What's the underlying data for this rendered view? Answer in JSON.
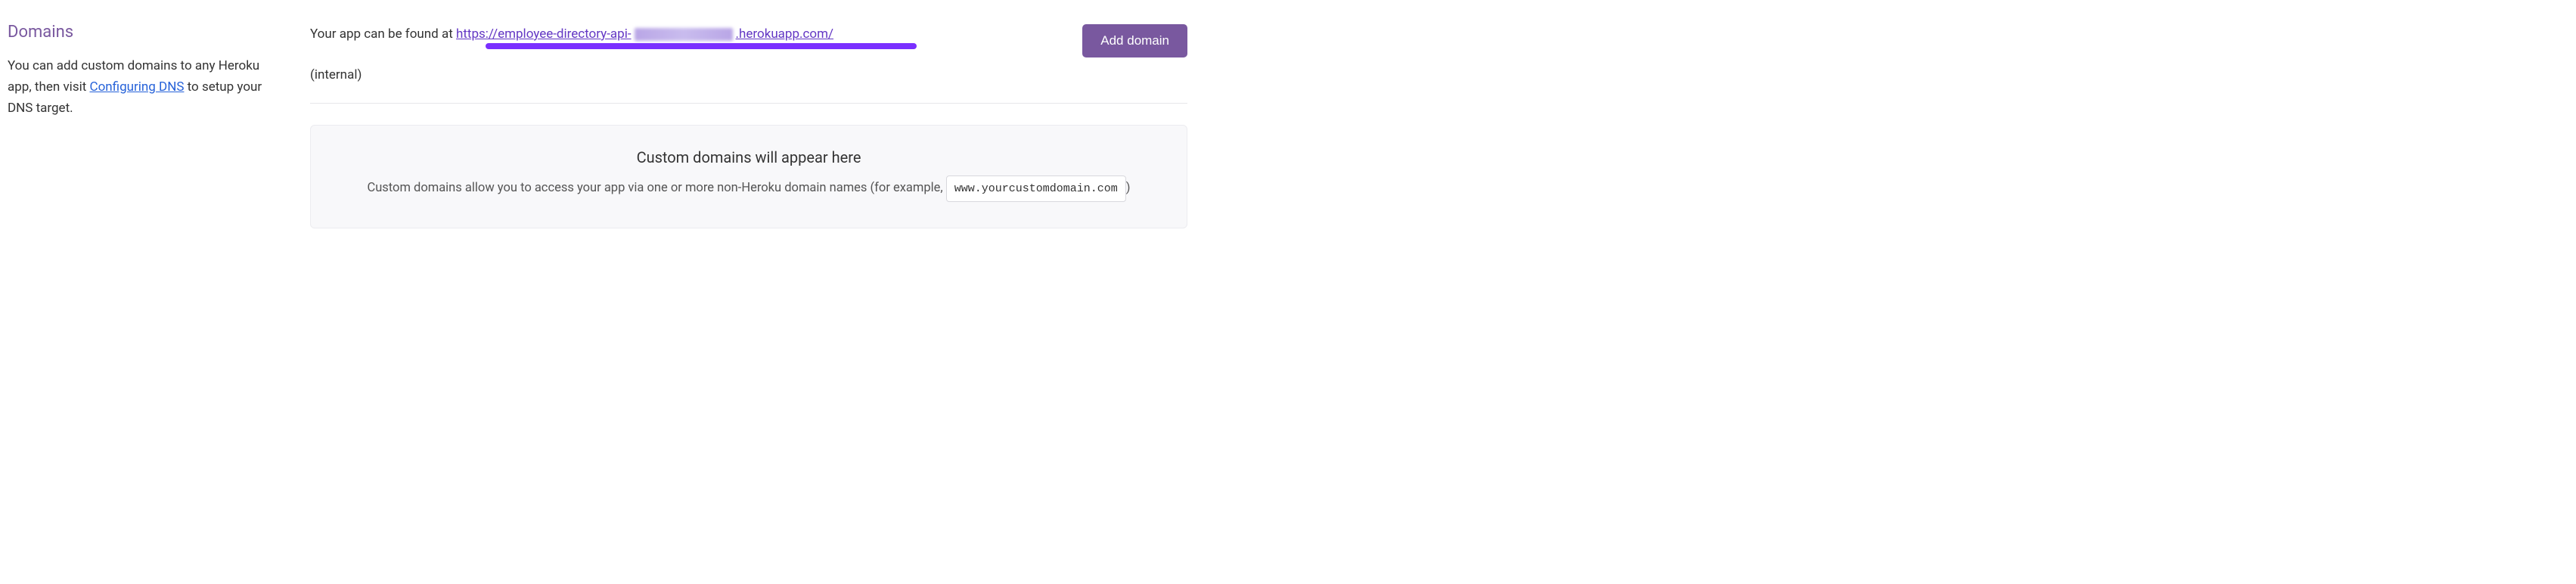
{
  "sidebar": {
    "title": "Domains",
    "desc_before": "You can add custom domains to any Heroku app, then visit ",
    "desc_link": "Configuring DNS",
    "desc_after": " to setup your DNS target."
  },
  "header": {
    "prefix": "Your app can be found at ",
    "url_part1": "https://employee-directory-api-",
    "url_part2": ".herokuapp.com/",
    "suffix": "(internal)",
    "add_button": "Add domain"
  },
  "empty_state": {
    "title": "Custom domains will appear here",
    "desc_before": "Custom domains allow you to access your app via one or more non-Heroku domain names (for example, ",
    "example_code": "www.yourcustomdomain.com",
    "desc_after": ")"
  }
}
